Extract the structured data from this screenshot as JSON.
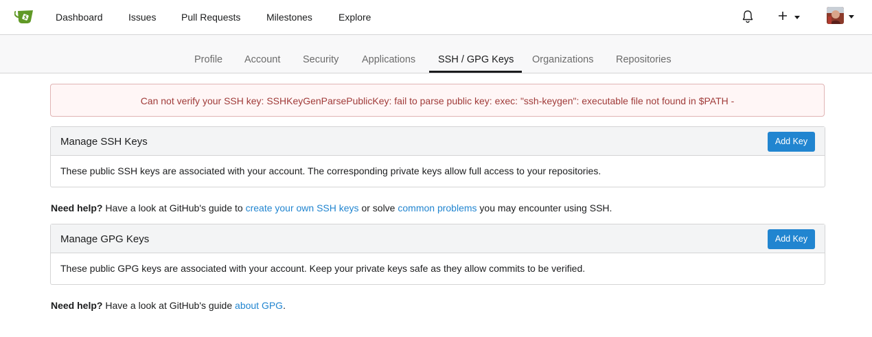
{
  "navbar": {
    "items": [
      {
        "label": "Dashboard"
      },
      {
        "label": "Issues"
      },
      {
        "label": "Pull Requests"
      },
      {
        "label": "Milestones"
      },
      {
        "label": "Explore"
      }
    ],
    "icons": {
      "logo": "gitea-tea-icon",
      "notifications": "bell-icon",
      "create": "plus-icon",
      "user": "avatar"
    }
  },
  "tabs": [
    {
      "label": "Profile"
    },
    {
      "label": "Account"
    },
    {
      "label": "Security"
    },
    {
      "label": "Applications"
    },
    {
      "label": "SSH / GPG Keys",
      "active": true
    },
    {
      "label": "Organizations"
    },
    {
      "label": "Repositories"
    }
  ],
  "error": {
    "text": "Can not verify your SSH key: SSHKeyGenParsePublicKey: fail to parse public key: exec: \"ssh-keygen\": executable file not found in $PATH -"
  },
  "ssh": {
    "title": "Manage SSH Keys",
    "button": "Add Key",
    "description": "These public SSH keys are associated with your account. The corresponding private keys allow full access to your repositories.",
    "help": {
      "strong": "Need help?",
      "text1": " Have a look at GitHub's guide to ",
      "link1": "create your own SSH keys",
      "text2": " or solve ",
      "link2": "common problems",
      "text3": " you may encounter using SSH."
    }
  },
  "gpg": {
    "title": "Manage GPG Keys",
    "button": "Add Key",
    "description": "These public GPG keys are associated with your account. Keep your private keys safe as they allow commits to be verified.",
    "help": {
      "strong": "Need help?",
      "text1": " Have a look at GitHub's guide ",
      "link1": "about GPG",
      "text2": "."
    }
  },
  "colors": {
    "accent": "#2185d0",
    "error_text": "#9f3a38",
    "error_bg": "#fff6f6",
    "logo_green": "#609926"
  }
}
